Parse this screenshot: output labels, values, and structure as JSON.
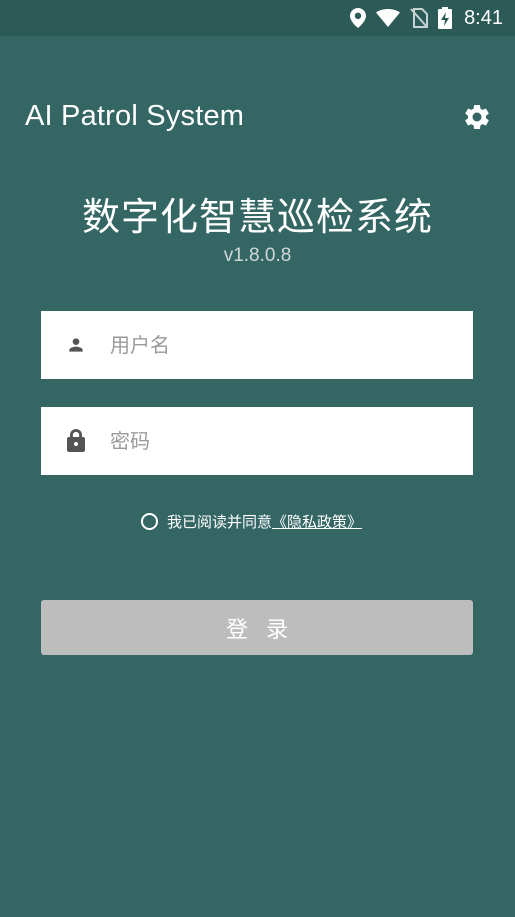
{
  "status_bar": {
    "time": "8:41",
    "icons": [
      "location-icon",
      "wifi-icon",
      "no-sim-icon",
      "battery-charging-icon"
    ]
  },
  "header": {
    "app_name": "AI Patrol System",
    "settings_icon": "gear-icon"
  },
  "title": "数字化智慧巡检系统",
  "version": "v1.8.0.8",
  "form": {
    "username_placeholder": "用户名",
    "username_value": "",
    "password_placeholder": "密码",
    "password_value": ""
  },
  "agreement": {
    "checked": false,
    "text": "我已阅读并同意",
    "policy_link": "《隐私政策》"
  },
  "login_button": "登录",
  "colors": {
    "background": "#346664",
    "status_bar": "#2b5a57",
    "button_disabled": "#bdbdbd"
  }
}
